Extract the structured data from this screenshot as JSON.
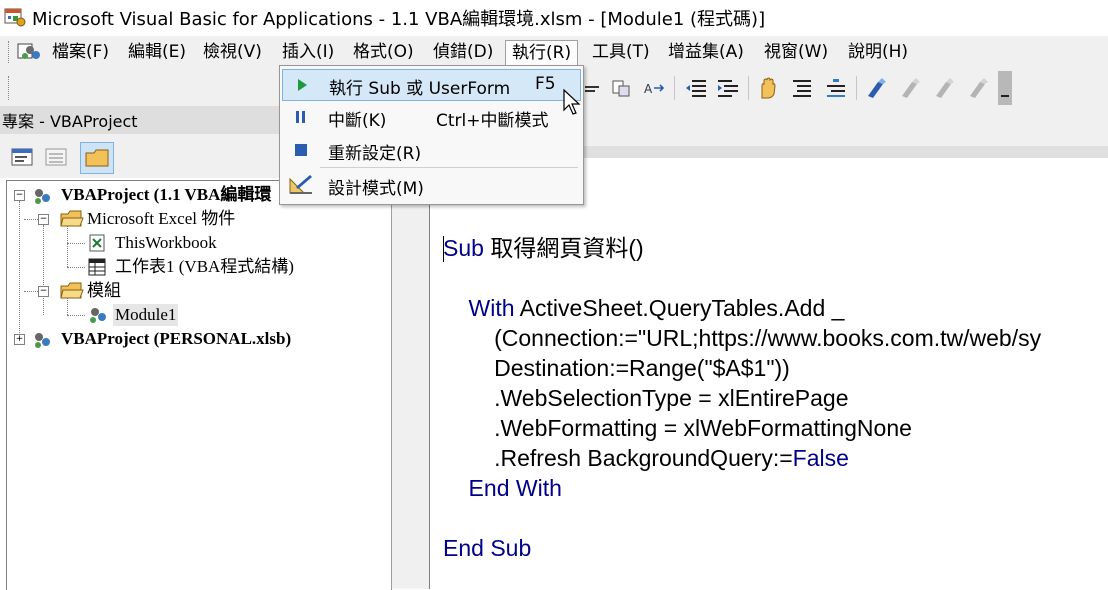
{
  "window": {
    "title": "Microsoft Visual Basic for Applications - 1.1 VBA編輯環境.xlsm - [Module1 (程式碼)]"
  },
  "menubar": {
    "items": [
      {
        "label": "檔案(F)"
      },
      {
        "label": "編輯(E)"
      },
      {
        "label": "檢視(V)"
      },
      {
        "label": "插入(I)"
      },
      {
        "label": "格式(O)"
      },
      {
        "label": "偵錯(D)"
      },
      {
        "label": "執行(R)"
      },
      {
        "label": "工具(T)"
      },
      {
        "label": "增益集(A)"
      },
      {
        "label": "視窗(W)"
      },
      {
        "label": "說明(H)"
      }
    ],
    "open_menu": "執行(R)"
  },
  "run_menu": {
    "items": [
      {
        "label": "執行 Sub 或 UserForm",
        "shortcut": "F5",
        "icon": "play-icon"
      },
      {
        "label": "中斷(K)",
        "shortcut": "Ctrl+中斷模式",
        "icon": "pause-icon"
      },
      {
        "label": "重新設定(R)",
        "shortcut": "",
        "icon": "stop-icon"
      },
      {
        "label": "設計模式(M)",
        "shortcut": "",
        "icon": "design-mode-icon"
      }
    ]
  },
  "project_panel": {
    "title": "專案 - VBAProject",
    "tree": [
      {
        "label": "VBAProject (1.1 VBA編輯環",
        "bold": true
      },
      {
        "label": "Microsoft Excel 物件",
        "bold": false
      },
      {
        "label": "ThisWorkbook",
        "bold": false
      },
      {
        "label": "工作表1 (VBA程式結構)",
        "bold": false
      },
      {
        "label": "模組",
        "bold": false
      },
      {
        "label": "Module1",
        "bold": false
      },
      {
        "label": "VBAProject (PERSONAL.xlsb)",
        "bold": true
      }
    ]
  },
  "code": {
    "lines": [
      {
        "kw": "Sub",
        "text": " 取得網頁資料()"
      },
      {
        "kw": "",
        "text": ""
      },
      {
        "kw": "    With",
        "text": " ActiveSheet.QueryTables.Add _"
      },
      {
        "kw": "",
        "text": "        (Connection:=\"URL;https://www.books.com.tw/web/sy"
      },
      {
        "kw": "",
        "text": "        Destination:=Range(\"$A$1\"))"
      },
      {
        "kw": "",
        "text": "        .WebSelectionType = xlEntirePage"
      },
      {
        "kw": "",
        "text": "        .WebFormatting = xlWebFormattingNone"
      },
      {
        "kw": "",
        "text": "        .Refresh BackgroundQuery:=",
        "kw2": "False"
      },
      {
        "kw": "    End With",
        "text": ""
      },
      {
        "kw": "",
        "text": ""
      },
      {
        "kw": "End Sub",
        "text": ""
      }
    ]
  },
  "colors": {
    "keyword": "#00008b",
    "menu_highlight": "#d5e8f8",
    "menu_highlight_border": "#7db4e4",
    "chrome": "#f0f0f0"
  }
}
